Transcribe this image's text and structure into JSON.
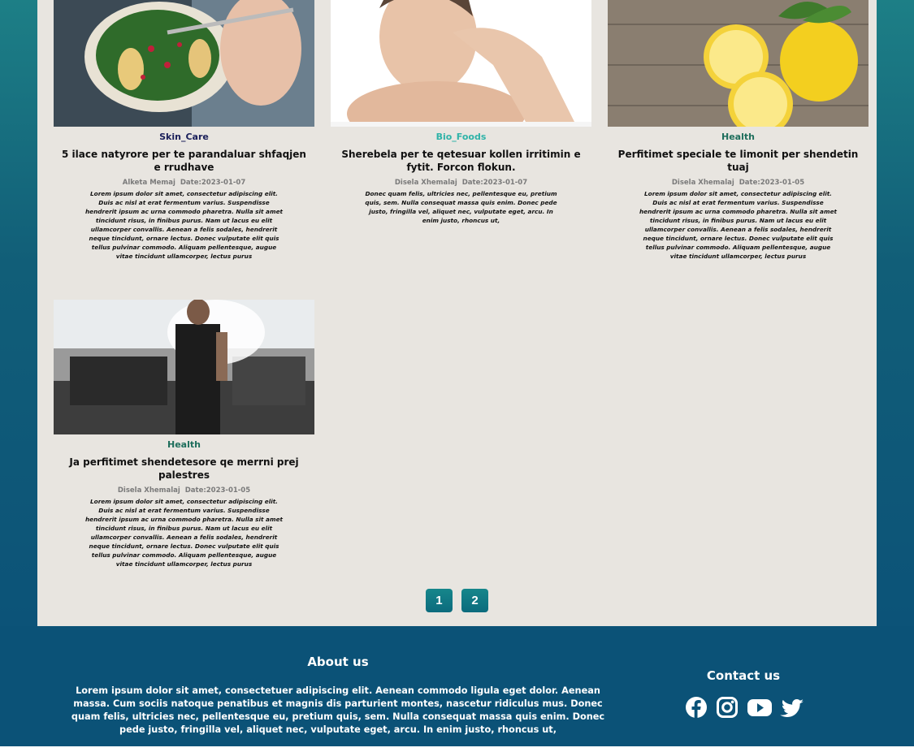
{
  "articles": [
    {
      "category": "Skin_Care",
      "category_color": "#1a1f5a",
      "title": "5 ilace natyrore per te parandaluar shfaqjen e rrudhave",
      "author": "Alketa Memaj",
      "date": "Date:2023-01-07",
      "excerpt": "Lorem ipsum dolor sit amet, consectetur adipiscing elit. Duis ac nisl at erat fermentum varius. Suspendisse hendrerit ipsum ac urna commodo pharetra. Nulla sit amet tincidunt risus, in finibus purus. Nam ut lacus eu elit ullamcorper convallis. Aenean a felis sodales, hendrerit neque tincidunt, ornare lectus. Donec vulputate elit quis tellus pulvinar commodo. Aliquam pellentesque, augue vitae tincidunt ullamcorper, lectus purus"
    },
    {
      "category": "Bio_Foods",
      "category_color": "#2fb3a8",
      "title": "Sherebela per te qetesuar kollen irritimin e fytit. Forcon flokun.",
      "author": "Disela Xhemalaj",
      "date": "Date:2023-01-07",
      "excerpt": "Donec quam felis, ultricies nec, pellentesque eu, pretium quis, sem. Nulla consequat massa quis enim. Donec pede justo, fringilla vel, aliquet nec, vulputate eget, arcu. In enim justo, rhoncus ut,"
    },
    {
      "category": "Health",
      "category_color": "#1e6e5c",
      "title": "Perfitimet speciale te limonit per shendetin tuaj",
      "author": "Disela Xhemalaj",
      "date": "Date:2023-01-05",
      "excerpt": "Lorem ipsum dolor sit amet, consectetur adipiscing elit. Duis ac nisl at erat fermentum varius. Suspendisse hendrerit ipsum ac urna commodo pharetra. Nulla sit amet tincidunt risus, in finibus purus. Nam ut lacus eu elit ullamcorper convallis. Aenean a felis sodales, hendrerit neque tincidunt, ornare lectus. Donec vulputate elit quis tellus pulvinar commodo. Aliquam pellentesque, augue vitae tincidunt ullamcorper, lectus purus"
    },
    {
      "category": "Health",
      "category_color": "#1e6e5c",
      "title": "Ja perfitimet shendetesore qe merrni prej palestres",
      "author": "Disela Xhemalaj",
      "date": "Date:2023-01-05",
      "excerpt": "Lorem ipsum dolor sit amet, consectetur adipiscing elit. Duis ac nisl at erat fermentum varius. Suspendisse hendrerit ipsum ac urna commodo pharetra. Nulla sit amet tincidunt risus, in finibus purus. Nam ut lacus eu elit ullamcorper convallis. Aenean a felis sodales, hendrerit neque tincidunt, ornare lectus. Donec vulputate elit quis tellus pulvinar commodo. Aliquam pellentesque, augue vitae tincidunt ullamcorper, lectus purus"
    }
  ],
  "pagination": {
    "pages": [
      "1",
      "2"
    ]
  },
  "footer": {
    "about_title": "About us",
    "about_text": "Lorem ipsum dolor sit amet, consectetuer adipiscing elit. Aenean commodo ligula eget dolor. Aenean massa. Cum sociis natoque penatibus et magnis dis parturient montes, nascetur ridiculus mus. Donec quam felis, ultricies nec, pellentesque eu, pretium quis, sem. Nulla consequat massa quis enim. Donec pede justo, fringilla vel, aliquet nec, vulputate eget, arcu. In enim justo, rhoncus ut,",
    "contact_title": "Contact us",
    "social_icons": [
      "facebook-icon",
      "instagram-icon",
      "youtube-icon",
      "twitter-icon"
    ]
  }
}
